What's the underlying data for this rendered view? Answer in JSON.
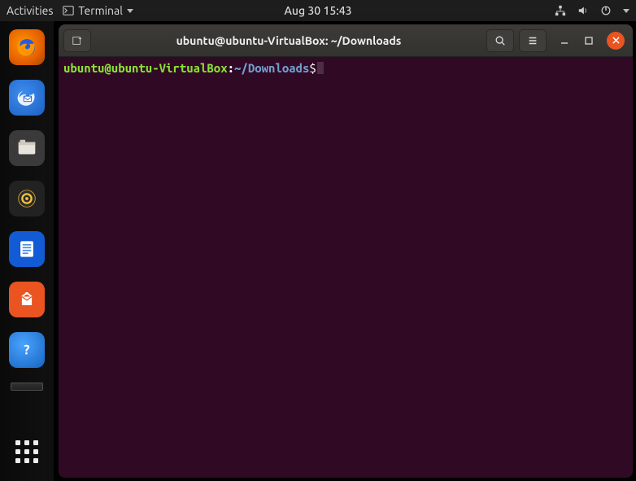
{
  "top_panel": {
    "activities": "Activities",
    "app_indicator": "Terminal",
    "clock": "Aug 30  15:43"
  },
  "dock": {
    "items": [
      "firefox",
      "thunderbird",
      "files",
      "rhythmbox",
      "libreoffice-writer",
      "ubuntu-software",
      "help"
    ],
    "tray": "minimized-tray",
    "apps_button": "show-applications"
  },
  "window": {
    "title": "ubuntu@ubuntu-VirtualBox: ~/Downloads",
    "prompt": {
      "userhost": "ubuntu@ubuntu-VirtualBox",
      "colon": ":",
      "path": "~/Downloads",
      "dollar": "$"
    }
  }
}
